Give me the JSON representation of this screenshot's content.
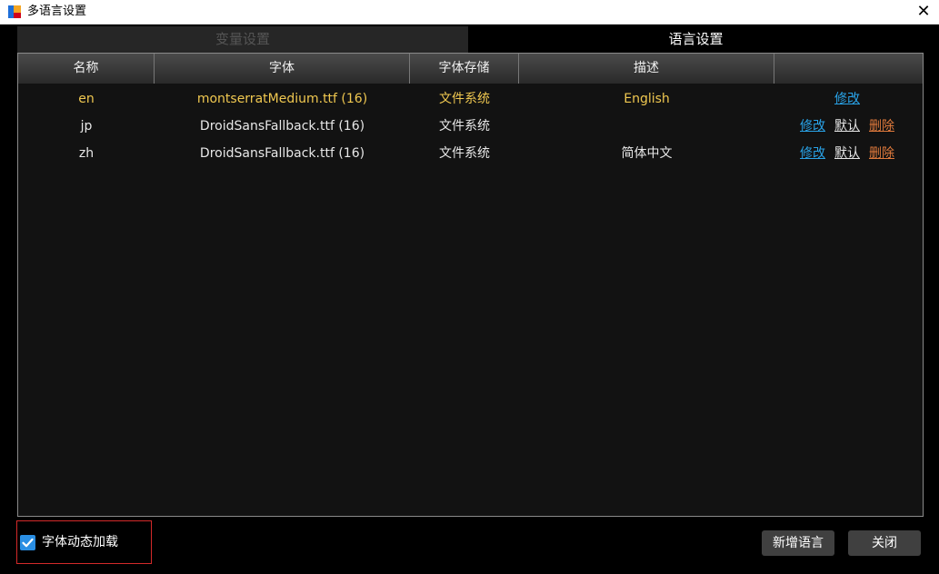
{
  "window": {
    "title": "多语言设置"
  },
  "tabs": [
    {
      "label": "变量设置",
      "active": false
    },
    {
      "label": "语言设置",
      "active": true
    }
  ],
  "table": {
    "columns": [
      "名称",
      "字体",
      "字体存储",
      "描述",
      ""
    ],
    "rows": [
      {
        "name": "en",
        "font": "montserratMedium.ttf (16)",
        "storage": "文件系统",
        "desc": "English",
        "highlighted": true,
        "actions": [
          "修改"
        ]
      },
      {
        "name": "jp",
        "font": "DroidSansFallback.ttf (16)",
        "storage": "文件系统",
        "desc": "",
        "highlighted": false,
        "actions": [
          "修改",
          "默认",
          "删除"
        ]
      },
      {
        "name": "zh",
        "font": "DroidSansFallback.ttf (16)",
        "storage": "文件系统",
        "desc": "简体中文",
        "highlighted": false,
        "actions": [
          "修改",
          "默认",
          "删除"
        ]
      }
    ]
  },
  "options": {
    "dynamic_font_label": "字体动态加载",
    "dynamic_font_checked": true
  },
  "buttons": {
    "add_language": "新增语言",
    "close": "关闭"
  },
  "colors": {
    "checkbox_accent": "#2a8ee3",
    "edit_link": "#29a3e8",
    "delete_link": "#e07a3c",
    "highlight_row_text": "#f0c850",
    "focus_border": "#d42a2a"
  }
}
